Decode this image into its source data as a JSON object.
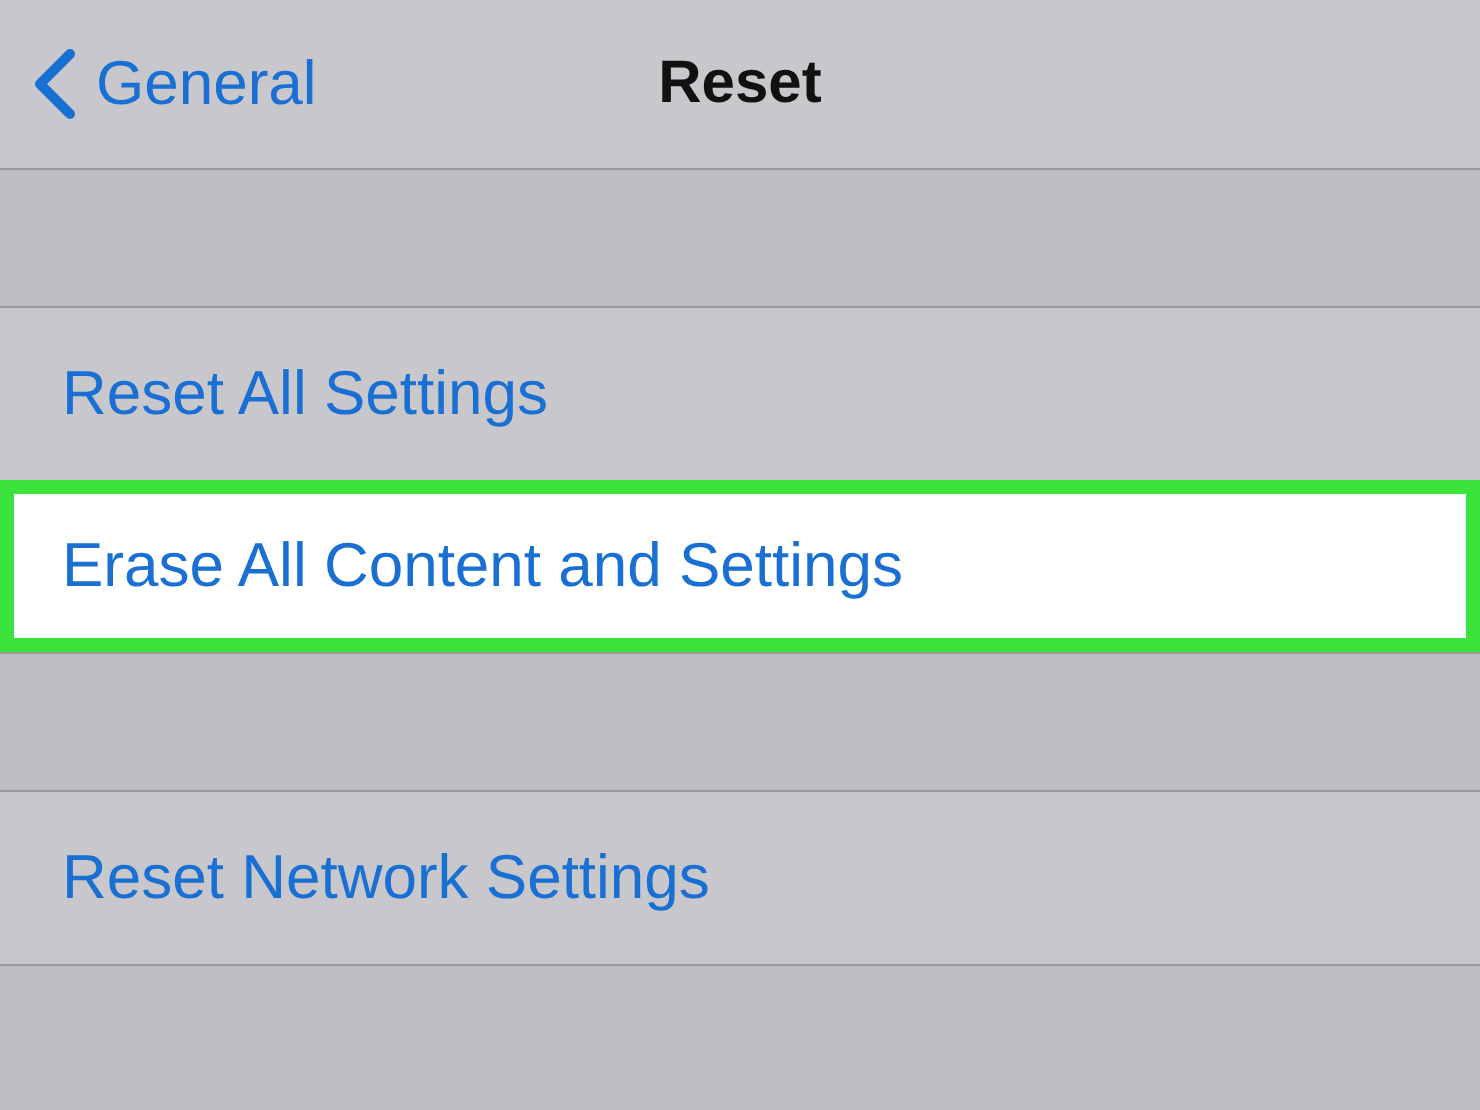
{
  "nav": {
    "back": "General",
    "title": "Reset"
  },
  "groups": [
    {
      "rows": [
        {
          "label": "Reset All Settings",
          "highlighted": false
        },
        {
          "label": "Erase All Content and Settings",
          "highlighted": true
        }
      ]
    },
    {
      "rows": [
        {
          "label": "Reset Network Settings",
          "highlighted": false
        }
      ]
    }
  ]
}
